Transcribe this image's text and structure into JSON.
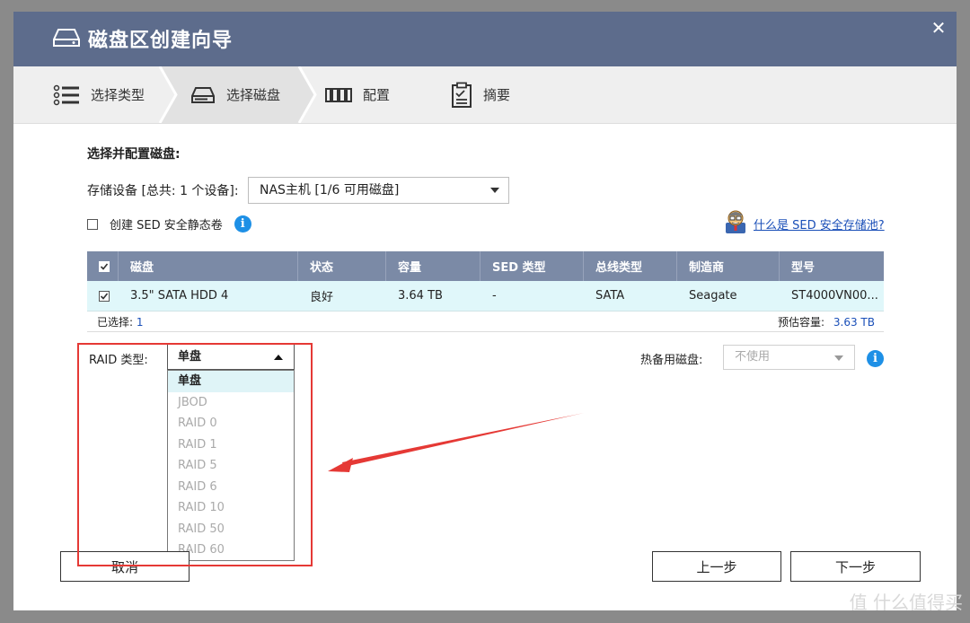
{
  "dialog": {
    "title": "磁盘区创建向导",
    "close_symbol": "✕"
  },
  "steps": [
    {
      "label": "选择类型",
      "icon": "list-icon"
    },
    {
      "label": "选择磁盘",
      "icon": "disk-icon",
      "active": true
    },
    {
      "label": "配置",
      "icon": "raid-icon"
    },
    {
      "label": "摘要",
      "icon": "clipboard-icon"
    }
  ],
  "section_title": "选择并配置磁盘:",
  "storage": {
    "label": "存储设备 [总共: 1 个设备]:",
    "value": "NAS主机 [1/6 可用磁盘]"
  },
  "sed": {
    "checkbox_label": "创建 SED 安全静态卷",
    "info": "i",
    "help_link": "什么是 SED 安全存储池?"
  },
  "table": {
    "headers": [
      "磁盘",
      "状态",
      "容量",
      "SED 类型",
      "总线类型",
      "制造商",
      "型号"
    ],
    "rows": [
      {
        "disk": "3.5\" SATA HDD 4",
        "status": "良好",
        "capacity": "3.64 TB",
        "sed_type": "-",
        "bus": "SATA",
        "maker": "Seagate",
        "model": "ST4000VN00..."
      }
    ],
    "selected_label": "已选择:",
    "selected_count": "1",
    "estimated_label": "预估容量:",
    "estimated_value": "3.63 TB"
  },
  "raid": {
    "label": "RAID 类型:",
    "selected": "单盘",
    "options": [
      "单盘",
      "JBOD",
      "RAID 0",
      "RAID 1",
      "RAID 5",
      "RAID 6",
      "RAID 10",
      "RAID 50",
      "RAID 60"
    ]
  },
  "spare": {
    "label": "热备用磁盘:",
    "value": "不使用",
    "info": "i"
  },
  "buttons": {
    "cancel": "取消",
    "prev": "上一步",
    "next": "下一步"
  },
  "watermark": "值 什么值得买",
  "colors": {
    "titlebar": "#5d6c8c",
    "table_header": "#7b8aa6",
    "row_selected": "#e0f7fa",
    "annotation": "#e53935",
    "link": "#1a4fb8"
  }
}
